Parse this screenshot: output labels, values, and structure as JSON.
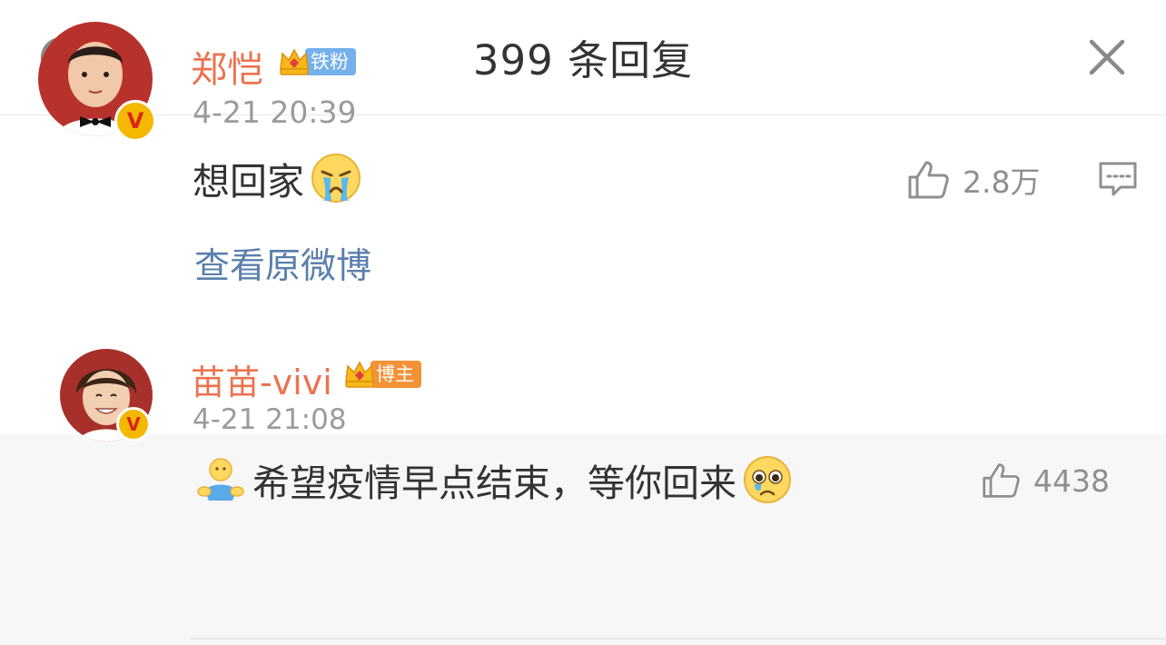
{
  "header": {
    "title": "399 条回复",
    "refresh_icon": "refresh-icon",
    "close_icon": "close-icon"
  },
  "main_comment": {
    "username": "郑恺",
    "badge_label": "铁粉",
    "timestamp": "4-21 20:39",
    "text": "想回家",
    "emoji": "crying-face-emoji",
    "likes": "2.8万",
    "view_original": "查看原微博",
    "verified_mark": "V"
  },
  "reply": {
    "username": "苗苗-vivi",
    "badge_label": "博主",
    "timestamp": "4-21 21:08",
    "text": "希望疫情早点结束，等你回来",
    "likes": "4438",
    "verified_mark": "V"
  },
  "colors": {
    "username": "#eb7350",
    "link": "#5a7fac",
    "muted": "#9b9b9b",
    "badge_blue": "#74b0ea",
    "badge_orange": "#f39236",
    "reply_bg": "#f7f7f7"
  }
}
